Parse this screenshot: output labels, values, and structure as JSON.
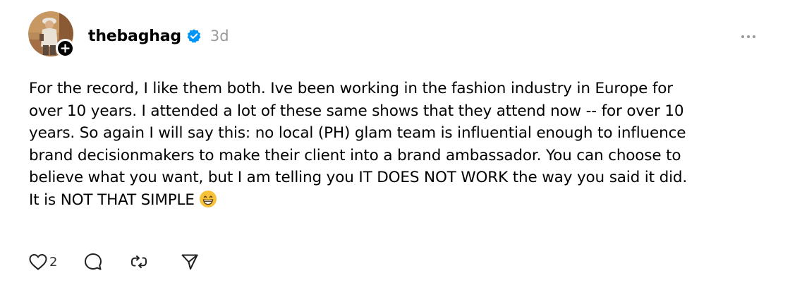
{
  "post": {
    "author": {
      "username": "thebaghag",
      "verified": true,
      "avatar_icon": "profile-photo",
      "follow_icon": "plus-icon"
    },
    "timestamp": "3d",
    "body_lines": [
      "For the record, I like them both. Ive been working in the fashion industry in Europe for",
      "over 10 years. I attended a lot of these same shows that they attend now -- for over 10",
      "years. So again I will say this: no local (PH) glam team is influential enough to influence",
      "brand decisionmakers to make their client into a brand ambassador. You can choose to",
      "believe what you want, but I am telling you IT DOES NOT WORK the way you said it did.",
      "It is NOT THAT SIMPLE"
    ],
    "body_emoji": "grinning-face-emoji",
    "actions": {
      "like_count": "2",
      "like_icon": "heart-icon",
      "reply_icon": "comment-icon",
      "repost_icon": "repost-icon",
      "share_icon": "send-icon"
    }
  },
  "colors": {
    "verified": "#0095f6",
    "muted": "#999999",
    "emoji": "#f7c23a"
  }
}
